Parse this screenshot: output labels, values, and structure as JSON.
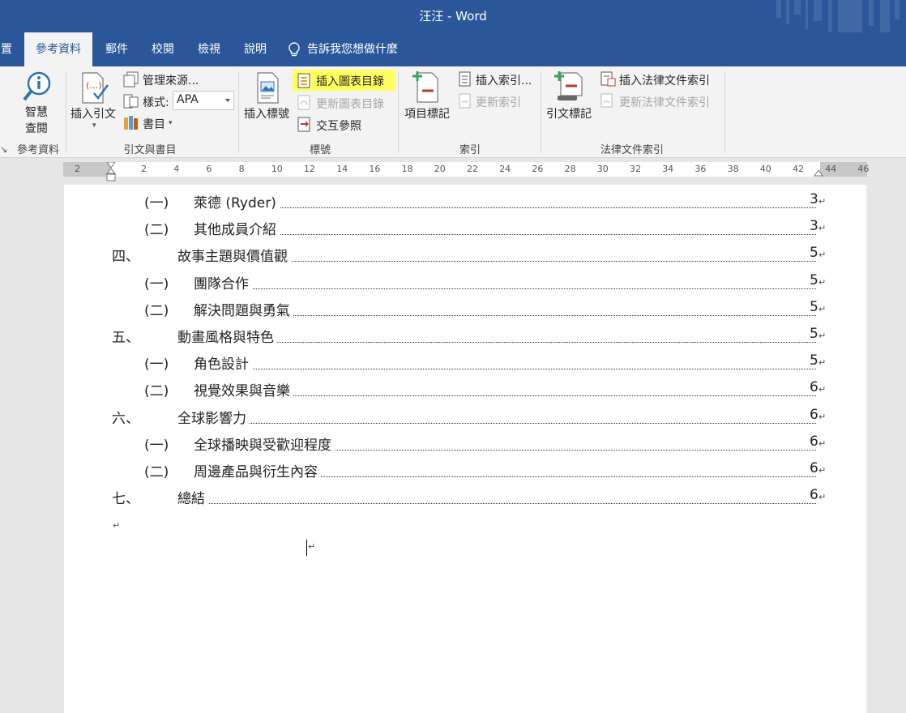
{
  "window": {
    "title": "汪汪  -  Word"
  },
  "tabs": [
    {
      "label": "置"
    },
    {
      "label": "參考資料",
      "active": true
    },
    {
      "label": "郵件"
    },
    {
      "label": "校閱"
    },
    {
      "label": "檢視"
    },
    {
      "label": "說明"
    }
  ],
  "tell_me": "告訴我您想做什麼",
  "ribbon": {
    "groups": [
      {
        "label": "參考資料"
      },
      {
        "label": "引文與書目"
      },
      {
        "label": "標號"
      },
      {
        "label": "索引"
      },
      {
        "label": "法律文件索引"
      }
    ],
    "smart_lookup": [
      "智慧",
      "查閱"
    ],
    "insert_citation": "插入引文",
    "manage_sources": "管理來源...",
    "style_label": "樣式:",
    "style_value": "APA",
    "bibliography": "書目",
    "insert_caption": "插入標號",
    "insert_table_of_figures": "插入圖表目錄",
    "update_table": "更新圖表目錄",
    "cross_reference": "交互參照",
    "mark_entry": "項目標記",
    "insert_index": "插入索引...",
    "update_index": "更新索引",
    "mark_citation": "引文標記",
    "insert_table_of_authorities": "插入法律文件索引",
    "update_table_of_authorities": "更新法律文件索引",
    "highlight_color": "#ffff5f"
  },
  "ruler": {
    "numbers": [
      "2",
      "2",
      "4",
      "6",
      "8",
      "10",
      "12",
      "14",
      "16",
      "18",
      "20",
      "22",
      "24",
      "26",
      "28",
      "30",
      "32",
      "34",
      "36",
      "38",
      "40",
      "42",
      "44",
      "46"
    ]
  },
  "toc": [
    {
      "num": "(一)",
      "text": "萊德 (Ryder)",
      "page": "3",
      "level": 2
    },
    {
      "num": "(二)",
      "text": "其他成員介紹",
      "page": "3",
      "level": 2
    },
    {
      "num": "四、",
      "text": "故事主題與價值觀",
      "page": "5",
      "level": 1
    },
    {
      "num": "(一)",
      "text": "團隊合作",
      "page": "5",
      "level": 2
    },
    {
      "num": "(二)",
      "text": "解決問題與勇氣",
      "page": "5",
      "level": 2
    },
    {
      "num": "五、",
      "text": "動畫風格與特色",
      "page": "5",
      "level": 1
    },
    {
      "num": "(一)",
      "text": "角色設計",
      "page": "5",
      "level": 2
    },
    {
      "num": "(二)",
      "text": "視覺效果與音樂",
      "page": "6",
      "level": 2
    },
    {
      "num": "六、",
      "text": "全球影響力",
      "page": "6",
      "level": 1
    },
    {
      "num": "(一)",
      "text": "全球播映與受歡迎程度",
      "page": "6",
      "level": 2
    },
    {
      "num": "(二)",
      "text": "周邊產品與衍生內容",
      "page": "6",
      "level": 2
    },
    {
      "num": "七、",
      "text": "總結",
      "page": "6",
      "level": 1
    }
  ],
  "paragraph_mark": "↵"
}
